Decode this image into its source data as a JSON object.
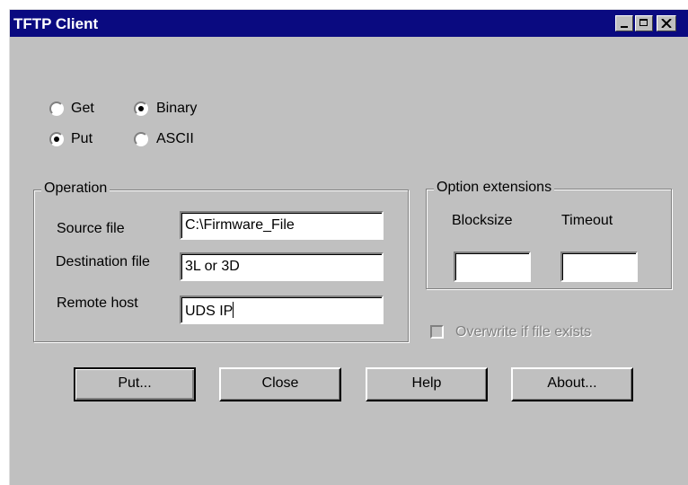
{
  "window": {
    "title": "TFTP Client"
  },
  "mode": {
    "get_label": "Get",
    "put_label": "Put",
    "binary_label": "Binary",
    "ascii_label": "ASCII",
    "selected_operation": "Put",
    "selected_format": "Binary"
  },
  "operation": {
    "legend": "Operation",
    "source_label": "Source file",
    "source_value": "C:\\Firmware_File",
    "destination_label": "Destination file",
    "destination_value": "3L or 3D",
    "remote_label": "Remote host",
    "remote_value": "UDS IP"
  },
  "options": {
    "legend": "Option extensions",
    "blocksize_label": "Blocksize",
    "blocksize_value": "",
    "timeout_label": "Timeout",
    "timeout_value": ""
  },
  "overwrite": {
    "label": "Overwrite if file exists",
    "checked": false,
    "enabled": false
  },
  "buttons": {
    "put": "Put...",
    "close": "Close",
    "help": "Help",
    "about": "About..."
  },
  "icons": [
    "minimize-icon",
    "maximize-icon",
    "close-icon"
  ],
  "colors": {
    "titlebar": "#0a0a80",
    "face": "#c0c0c0",
    "disabled_text": "#808080"
  }
}
